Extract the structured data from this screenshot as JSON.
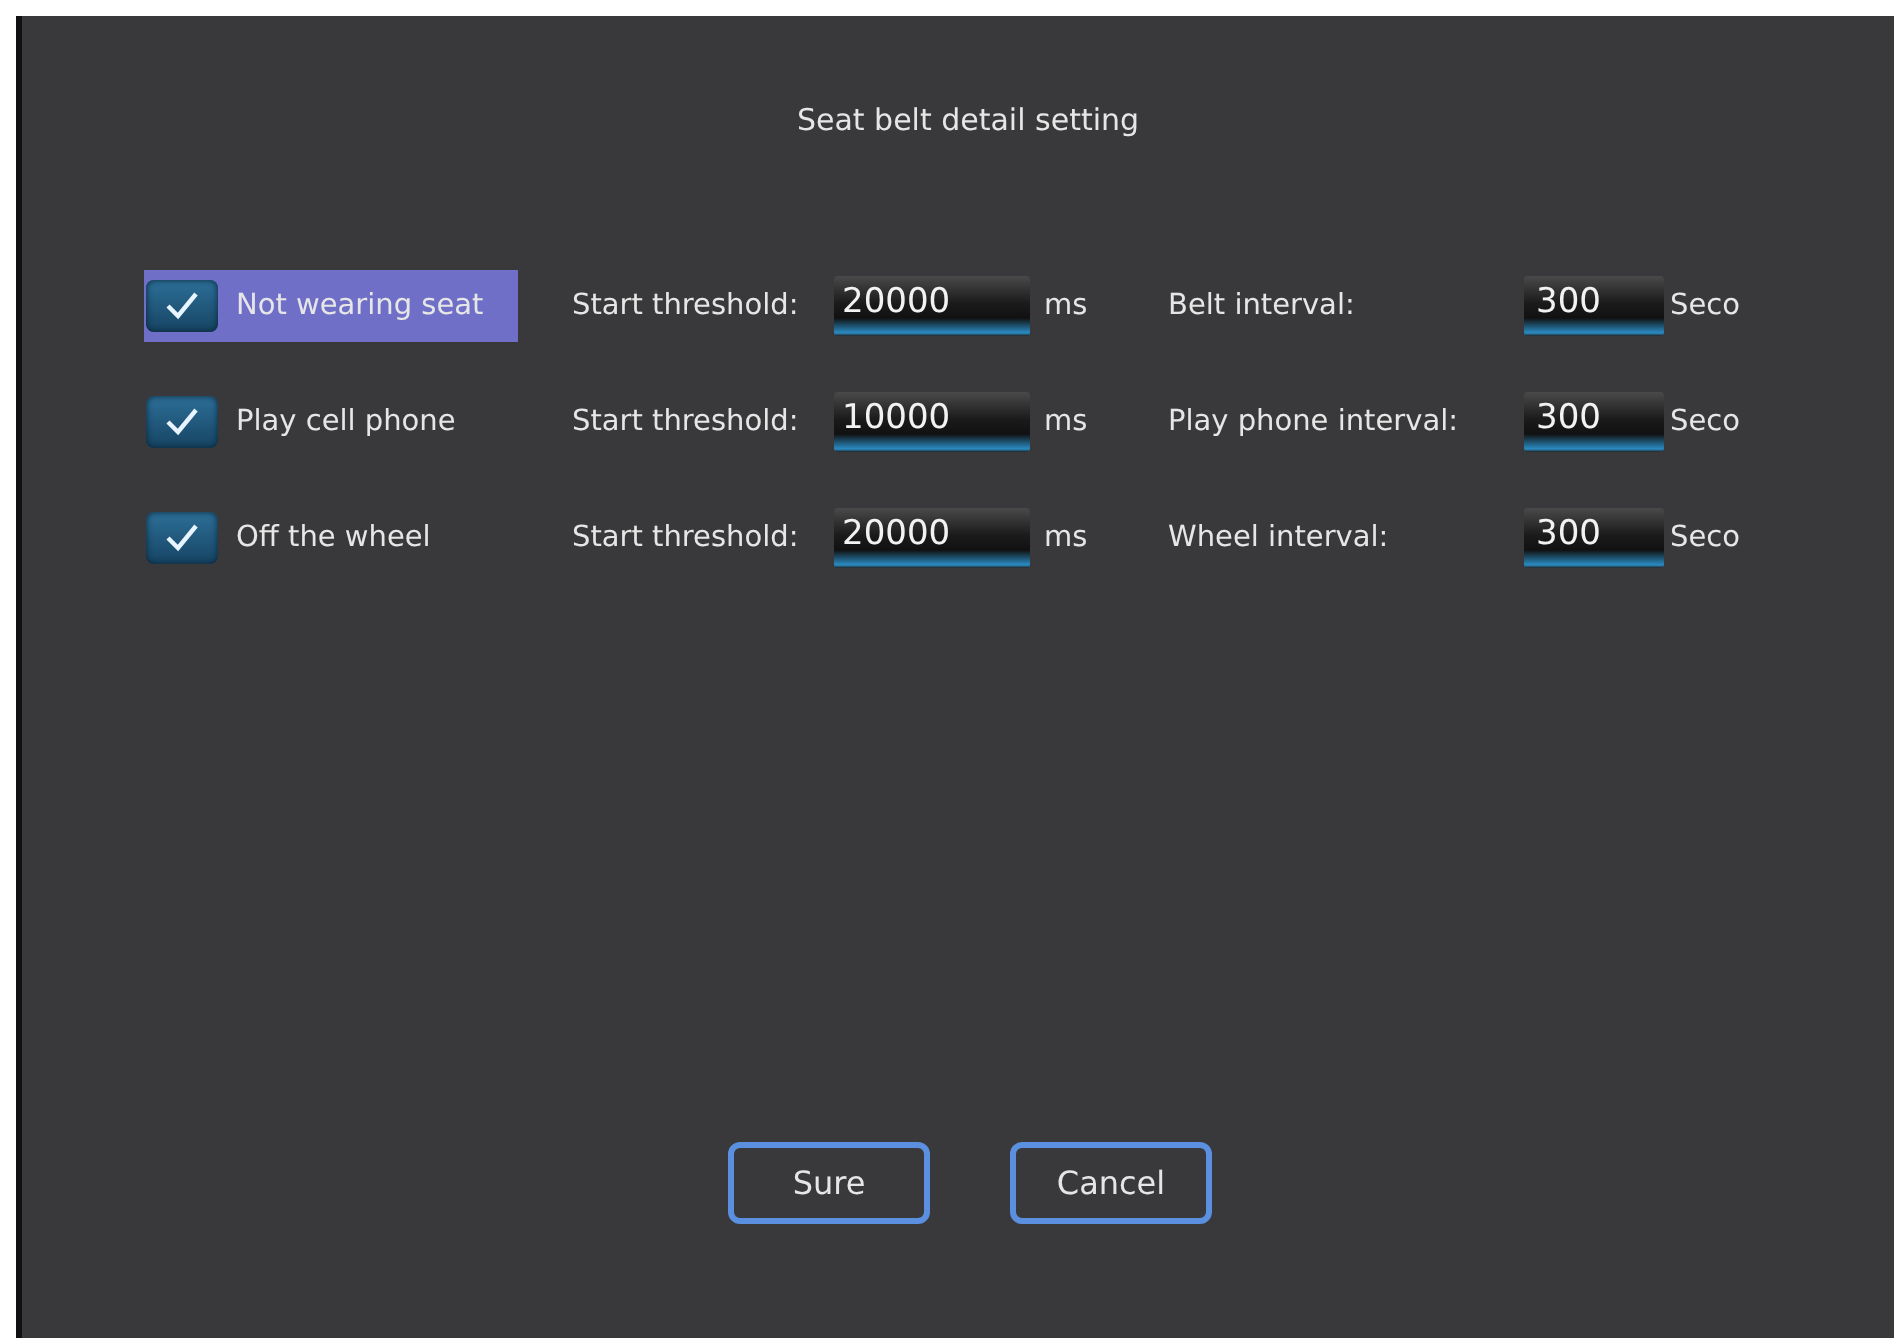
{
  "dialog": {
    "title": "Seat belt detail setting"
  },
  "rows": [
    {
      "label": "Not wearing seat",
      "checked": true,
      "selected": true,
      "threshold_label": "Start threshold:",
      "threshold": "20000",
      "threshold_unit": "ms",
      "interval_label": "Belt interval:",
      "interval": "300",
      "interval_unit": "Seco"
    },
    {
      "label": "Play cell phone",
      "checked": true,
      "selected": false,
      "threshold_label": "Start threshold:",
      "threshold": "10000",
      "threshold_unit": "ms",
      "interval_label": "Play phone interval:",
      "interval": "300",
      "interval_unit": "Seco"
    },
    {
      "label": "Off the wheel",
      "checked": true,
      "selected": false,
      "threshold_label": "Start threshold:",
      "threshold": "20000",
      "threshold_unit": "ms",
      "interval_label": "Wheel interval:",
      "interval": "300",
      "interval_unit": "Seco"
    }
  ],
  "buttons": [
    "Sure",
    "Cancel"
  ]
}
